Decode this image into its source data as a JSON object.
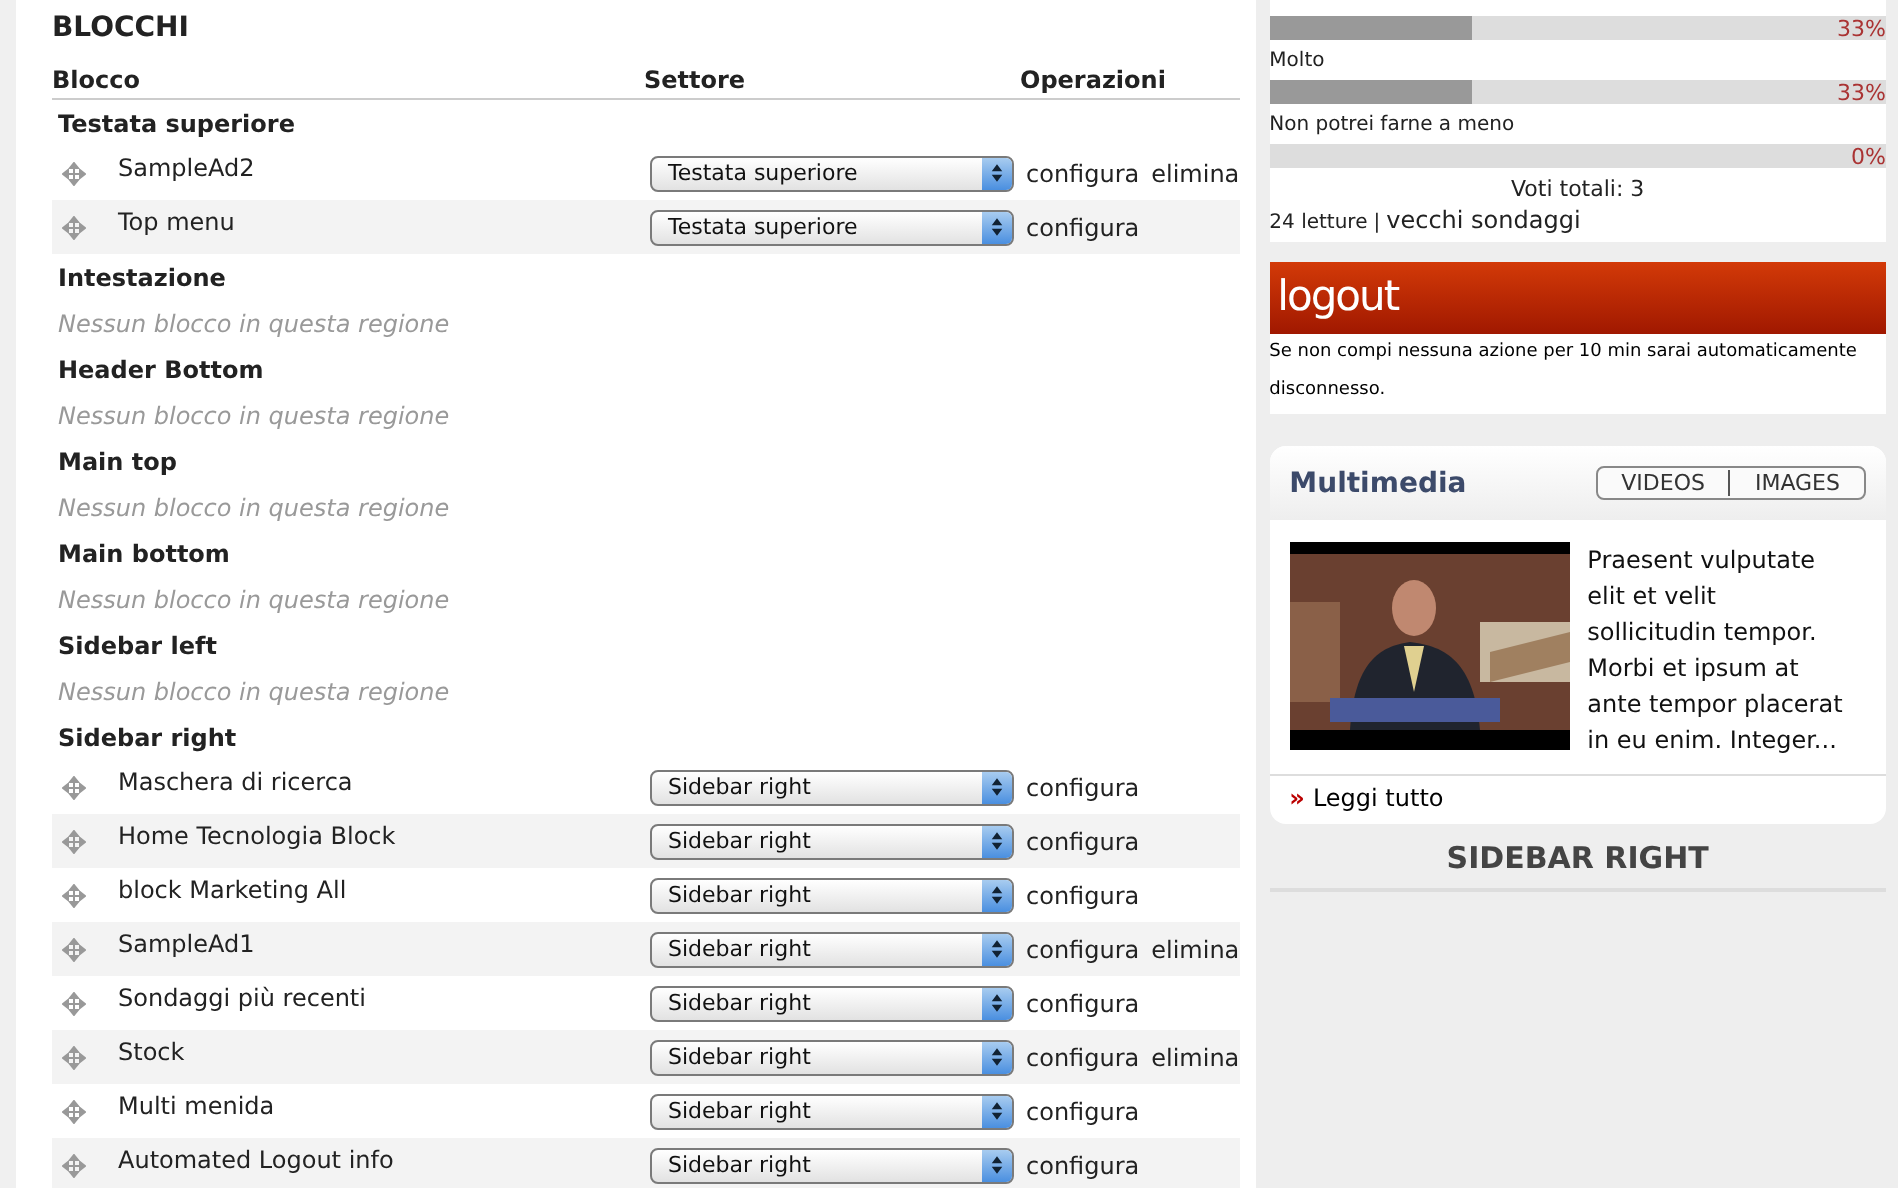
{
  "title": "BLOCCHI",
  "columns": [
    "Blocco",
    "Settore",
    "Operazioni"
  ],
  "regions": [
    {
      "name": "Testata superiore",
      "blocks": [
        {
          "name": "SampleAd2",
          "region": "Testata superiore",
          "operations": [
            "configura",
            "elimina"
          ]
        },
        {
          "name": "Top menu",
          "region": "Testata superiore",
          "operations": [
            "configura"
          ]
        }
      ]
    },
    {
      "name": "Intestazione",
      "empty_text": "Nessun blocco in questa regione"
    },
    {
      "name": "Header Bottom",
      "empty_text": "Nessun blocco in questa regione"
    },
    {
      "name": "Main top",
      "empty_text": "Nessun blocco in questa regione"
    },
    {
      "name": "Main bottom",
      "empty_text": "Nessun blocco in questa regione"
    },
    {
      "name": "Sidebar left",
      "empty_text": "Nessun blocco in questa regione"
    },
    {
      "name": "Sidebar right",
      "blocks": [
        {
          "name": "Maschera di ricerca",
          "region": "Sidebar right",
          "operations": [
            "configura"
          ]
        },
        {
          "name": "Home Tecnologia Block",
          "region": "Sidebar right",
          "operations": [
            "configura"
          ]
        },
        {
          "name": "block Marketing All",
          "region": "Sidebar right",
          "operations": [
            "configura"
          ]
        },
        {
          "name": "SampleAd1",
          "region": "Sidebar right",
          "operations": [
            "configura",
            "elimina"
          ]
        },
        {
          "name": "Sondaggi più recenti",
          "region": "Sidebar right",
          "operations": [
            "configura"
          ]
        },
        {
          "name": "Stock",
          "region": "Sidebar right",
          "operations": [
            "configura",
            "elimina"
          ]
        },
        {
          "name": "Multi menida",
          "region": "Sidebar right",
          "operations": [
            "configura"
          ]
        },
        {
          "name": "Automated Logout info",
          "region": "Sidebar right",
          "operations": [
            "configura"
          ]
        }
      ]
    }
  ],
  "sidebar": {
    "poll": {
      "options": [
        {
          "level": 0.33,
          "percent": "33%"
        },
        {
          "label": "Molto",
          "level": 0.33,
          "percent": "33%"
        },
        {
          "label": "Non potrei farne a meno",
          "level": 0,
          "percent": "0%"
        }
      ],
      "total": "Voti totali: 3",
      "reads": "24 letture",
      "separator": "|",
      "old_polls": "vecchi sondaggi"
    },
    "logout": {
      "title": "logout",
      "note": "Se non compi nessuna azione per 10 min sarai automaticamente disconnesso."
    },
    "multimedia": {
      "title": "Multimedia",
      "tabs": [
        "VIDEOS",
        "IMAGES"
      ],
      "text": "Praesent vulputate elit et velit sollicitudin tempor. Morbi et ipsum at ante tempor placerat in eu enim. Integer...",
      "more_icon": "»",
      "more": "Leggi tutto"
    },
    "region_label": "SIDEBAR RIGHT"
  }
}
